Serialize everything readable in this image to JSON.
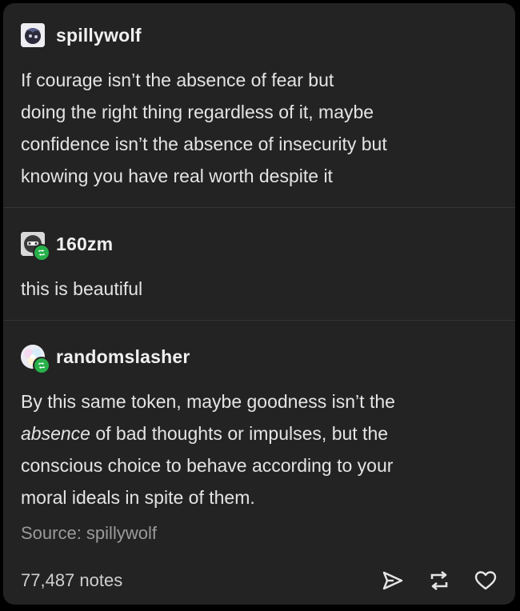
{
  "posts": [
    {
      "username": "spillywolf",
      "lines": [
        "If courage isn’t the absence of fear but",
        "doing the right thing regardless of it, maybe",
        "confidence isn’t the absence of insecurity but",
        "knowing you have real worth despite it"
      ]
    },
    {
      "username": "160zm",
      "lines": [
        "this is beautiful"
      ]
    },
    {
      "username": "randomslasher",
      "line1": "By this same token, maybe goodness isn’t the",
      "line2_em": "absence",
      "line2_rest": " of bad thoughts or impulses, but the",
      "line3": "conscious choice to behave according to your",
      "line4": "moral ideals in spite of them."
    }
  ],
  "source": "Source: spillywolf",
  "notes": "77,487 notes",
  "icons": {
    "share": "share-icon",
    "reblog": "reblog-icon",
    "like": "heart-icon"
  },
  "colors": {
    "card_bg": "#232323",
    "reblog_badge": "#27b04a"
  }
}
